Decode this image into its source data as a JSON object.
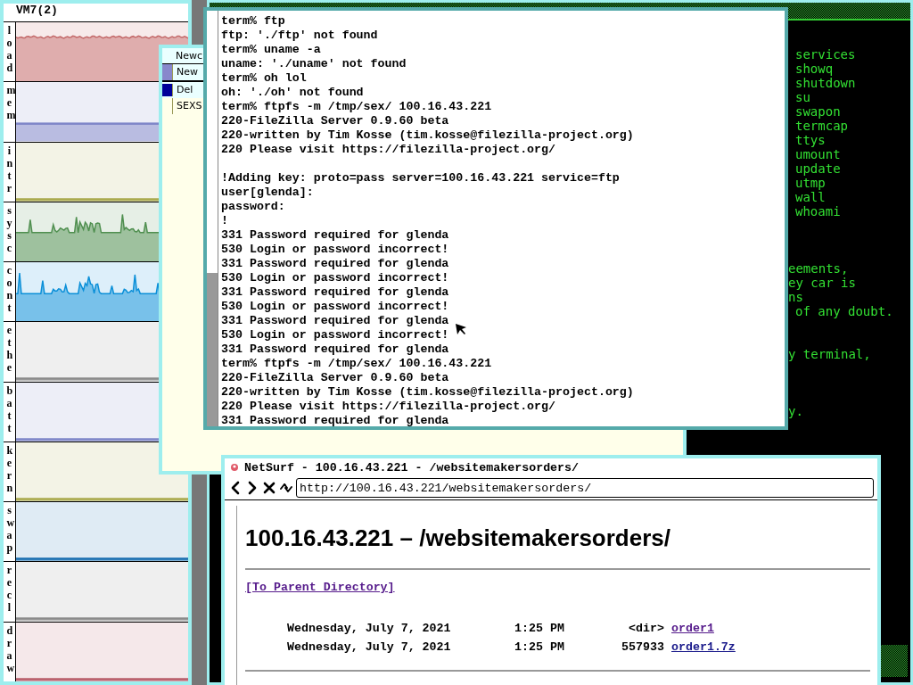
{
  "stats_window": {
    "title": "VM7(2)",
    "graphs": [
      {
        "label": "load",
        "color": "#c46a6a",
        "kind": "high"
      },
      {
        "label": "mem",
        "color": "#7f86c8",
        "kind": "mid"
      },
      {
        "label": "intr",
        "color": "#a9a94c",
        "kind": "flat"
      },
      {
        "label": "sysc",
        "color": "#4f8f4f",
        "kind": "spiky"
      },
      {
        "label": "cont",
        "color": "#0a8fd8",
        "kind": "spiky"
      },
      {
        "label": "ethe",
        "color": "#8a8a8a",
        "kind": "flat"
      },
      {
        "label": "batt",
        "color": "#7f86c8",
        "kind": "flat"
      },
      {
        "label": "kern",
        "color": "#a9a94c",
        "kind": "flat"
      },
      {
        "label": "swap",
        "color": "#1a6fb0",
        "kind": "flat"
      },
      {
        "label": "recl",
        "color": "#8a8a8a",
        "kind": "flat"
      },
      {
        "label": "draw",
        "color": "#b85c6a",
        "kind": "flat"
      }
    ]
  },
  "acme_window": {
    "tag": "Newc",
    "column_tag": "New",
    "window_tag": "Del",
    "body": "SEXS"
  },
  "terminal_window": {
    "lines": [
      {
        "kind": "text",
        "text": "term% ftp"
      },
      {
        "kind": "text",
        "text": "ftp: './ftp' not found"
      },
      {
        "kind": "text",
        "text": "term% uname -a"
      },
      {
        "kind": "text",
        "text": "uname: './uname' not found"
      },
      {
        "kind": "text",
        "text": "term% oh lol"
      },
      {
        "kind": "text",
        "text": "oh: './oh' not found"
      },
      {
        "kind": "text",
        "text": "term% ftpfs -m /tmp/sex/ 100.16.43.221"
      },
      {
        "kind": "text",
        "text": "220-FileZilla Server 0.9.60 beta"
      },
      {
        "kind": "text",
        "text": "220-written by Tim Kosse (tim.kosse@filezilla-project.org)"
      },
      {
        "kind": "text",
        "text": "220 Please visit https://filezilla-project.org/"
      },
      {
        "kind": "blank"
      },
      {
        "kind": "text",
        "text": "!Adding key: proto=pass server=100.16.43.221 service=ftp"
      },
      {
        "kind": "text",
        "text": "user[glenda]:"
      },
      {
        "kind": "text",
        "text": "password:"
      },
      {
        "kind": "text",
        "text": "!"
      },
      {
        "kind": "text",
        "text": "331 Password required for glenda"
      },
      {
        "kind": "text",
        "text": "530 Login or password incorrect!"
      },
      {
        "kind": "text",
        "text": "331 Password required for glenda"
      },
      {
        "kind": "text",
        "text": "530 Login or password incorrect!"
      },
      {
        "kind": "text",
        "text": "331 Password required for glenda"
      },
      {
        "kind": "text",
        "text": "530 Login or password incorrect!"
      },
      {
        "kind": "text",
        "text": "331 Password required for glenda"
      },
      {
        "kind": "text",
        "text": "530 Login or password incorrect!"
      },
      {
        "kind": "text",
        "text": "331 Password required for glenda"
      },
      {
        "kind": "text",
        "text": "term% ftpfs -m /tmp/sex/ 100.16.43.221"
      },
      {
        "kind": "text",
        "text": "220-FileZilla Server 0.9.60 beta"
      },
      {
        "kind": "text",
        "text": "220-written by Tim Kosse (tim.kosse@filezilla-project.org)"
      },
      {
        "kind": "text",
        "text": "220 Please visit https://filezilla-project.org/"
      },
      {
        "kind": "text",
        "text": "331 Password required for glenda"
      }
    ]
  },
  "console_window": {
    "lines": [
      {
        "kind": "text",
        "text": "services"
      },
      {
        "kind": "text",
        "text": "showq"
      },
      {
        "kind": "text",
        "text": "shutdown"
      },
      {
        "kind": "text",
        "text": "su"
      },
      {
        "kind": "text",
        "text": "swapon"
      },
      {
        "kind": "text",
        "text": "termcap"
      },
      {
        "kind": "text",
        "text": "ttys"
      },
      {
        "kind": "text",
        "text": "umount"
      },
      {
        "kind": "text",
        "text": "update"
      },
      {
        "kind": "text",
        "text": "utmp"
      },
      {
        "kind": "text",
        "text": "wall"
      },
      {
        "kind": "text",
        "text": "whoami"
      },
      {
        "kind": "blank"
      },
      {
        "kind": "blank"
      },
      {
        "kind": "blank"
      },
      {
        "kind": "cut",
        "text": "eements,"
      },
      {
        "kind": "cut",
        "text": "ey car is"
      },
      {
        "kind": "cut",
        "text": "ns"
      },
      {
        "kind": "text",
        "text": "of any doubt."
      },
      {
        "kind": "blank"
      },
      {
        "kind": "blank"
      },
      {
        "kind": "cut",
        "text": "y terminal,"
      },
      {
        "kind": "blank"
      },
      {
        "kind": "blank"
      },
      {
        "kind": "blank"
      },
      {
        "kind": "cut",
        "text": "y."
      }
    ]
  },
  "browser_window": {
    "title": "NetSurf - 100.16.43.221 - /websitemakersorders/",
    "url": "http://100.16.43.221/websitemakersorders/",
    "heading": "100.16.43.221 – /websitemakersorders/",
    "parent_link": {
      "text": "[To Parent Directory]",
      "visited": true
    },
    "entries": [
      {
        "date": "Wednesday, July 7, 2021",
        "time": "1:25 PM",
        "size": "<dir>",
        "name": "order1",
        "visited": true
      },
      {
        "date": "Wednesday, July 7, 2021",
        "time": "1:25 PM",
        "size": "557933",
        "name": "order1.7z",
        "visited": false
      }
    ]
  }
}
